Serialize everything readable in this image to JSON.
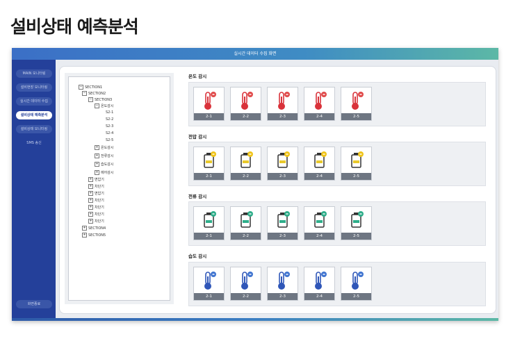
{
  "page_title": "설비상태 예측분석",
  "app": {
    "header_title": "실시간 데이터 수집 화면"
  },
  "sidebar": {
    "items": [
      {
        "label": "MAIN 모니터링"
      },
      {
        "label": "설비현장 모니터링"
      },
      {
        "label": "실시간 데이터 수집"
      },
      {
        "label": "설비상태 예측분석"
      },
      {
        "label": "설비상태 모니터링"
      },
      {
        "label": "SMS 송신"
      }
    ],
    "logout_label": "화면종료"
  },
  "tree": {
    "nodes": [
      {
        "label": "SECTION1",
        "sign": "−"
      },
      {
        "label": "SECTION2",
        "sign": "−"
      },
      {
        "label": "SECTION3",
        "sign": "−"
      },
      {
        "label": "온도감시",
        "sign": "−"
      },
      {
        "label": "S2-1"
      },
      {
        "label": "S2-2"
      },
      {
        "label": "S2-3"
      },
      {
        "label": "S2-4"
      },
      {
        "label": "S2-5"
      },
      {
        "label": "온도감시",
        "sign": "+"
      },
      {
        "label": "전류감시",
        "sign": "+"
      },
      {
        "label": "습도감시",
        "sign": "+"
      },
      {
        "label": "에어감시",
        "sign": "+"
      },
      {
        "label": "변압기",
        "sign": "+"
      },
      {
        "label": "차단기",
        "sign": "+"
      },
      {
        "label": "변압기",
        "sign": "+"
      },
      {
        "label": "차단기",
        "sign": "+"
      },
      {
        "label": "차단기",
        "sign": "+"
      },
      {
        "label": "차단기",
        "sign": "+"
      },
      {
        "label": "차단기",
        "sign": "+"
      },
      {
        "label": "SECTION4",
        "sign": "+"
      },
      {
        "label": "SECTION5",
        "sign": "+"
      }
    ]
  },
  "sections": [
    {
      "title": "온도 감시",
      "icon": "thermometer-icon",
      "color": "#d9323a",
      "badge": "#e04a4a",
      "cards": [
        "2-1",
        "2-2",
        "2-3",
        "2-4",
        "2-5"
      ]
    },
    {
      "title": "전압 감시",
      "icon": "battery-icon",
      "color": "#e9c92a",
      "badge": "#f0c419",
      "cards": [
        "2-1",
        "2-2",
        "2-3",
        "2-4",
        "2-5"
      ]
    },
    {
      "title": "전류 감시",
      "icon": "battery-icon",
      "color": "#2fae8a",
      "badge": "#2fae8a",
      "cards": [
        "2-1",
        "2-2",
        "2-3",
        "2-4",
        "2-5"
      ]
    },
    {
      "title": "습도 감시",
      "icon": "thermometer-icon",
      "color": "#2f56b8",
      "badge": "#3f74d0",
      "cards": [
        "2-1",
        "2-2",
        "2-3",
        "2-4",
        "2-5"
      ]
    }
  ]
}
